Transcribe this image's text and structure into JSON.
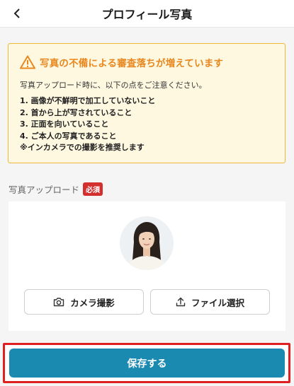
{
  "header": {
    "back_icon": "chevron-left-icon",
    "title": "プロフィール写真"
  },
  "warning": {
    "icon": "warning-triangle-icon",
    "title": "写真の不備による審査落ちが増えています",
    "intro": "写真アップロード時に、以下の点をご注意ください。",
    "items": [
      "1. 画像が不鮮明で加工していないこと",
      "2. 首から上が写されていること",
      "3. 正面を向いていること",
      "4. ご本人の写真であること",
      "※インカメラでの撮影を推奨します"
    ],
    "colors": {
      "accent": "#e8871e",
      "background": "#fff8e1",
      "border": "#f2b63b"
    }
  },
  "upload": {
    "label": "写真アップロード",
    "required_badge": "必須",
    "camera_button": "カメラ撮影",
    "file_button": "ファイル選択"
  },
  "save_button": "保存する",
  "colors": {
    "primary": "#1b8ab0",
    "required": "#d32f2f",
    "highlight": "#e02020"
  }
}
